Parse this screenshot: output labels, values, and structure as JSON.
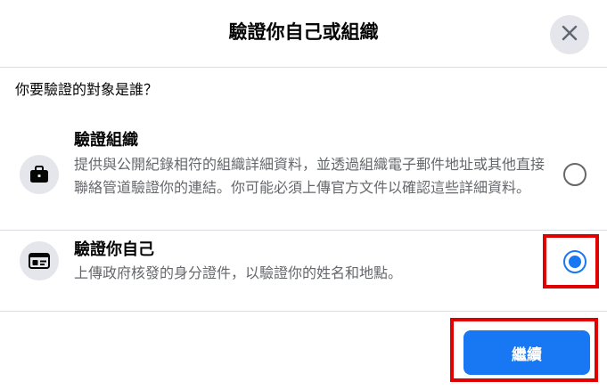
{
  "dialog": {
    "title": "驗證你自己或組織",
    "close_icon": "close-icon"
  },
  "question": "你要驗證的對象是誰？",
  "options": [
    {
      "title": "驗證組織",
      "description": "提供與公開紀錄相符的組織詳細資料，並透過組織電子郵件地址或其他直接聯絡管道驗證你的連結。你可能必須上傳官方文件以確認這些詳細資料。",
      "icon": "briefcase-icon",
      "selected": false
    },
    {
      "title": "驗證你自己",
      "description": "上傳政府核發的身分證件，以驗證你的姓名和地點。",
      "icon": "id-card-icon",
      "selected": true
    }
  ],
  "footer": {
    "continue_label": "繼續"
  },
  "colors": {
    "accent": "#1877f2",
    "highlight_box": "#e00000",
    "secondary_text": "#65676b",
    "icon_bg": "#e4e6eb"
  }
}
